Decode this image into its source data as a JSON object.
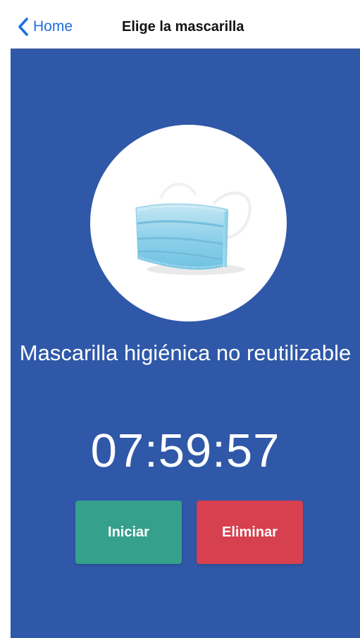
{
  "nav": {
    "back_label": "Home",
    "back_icon": "chevron-left-icon",
    "title": "Elige la mascarilla"
  },
  "mask": {
    "image_icon": "surgical-mask-icon",
    "name": "Mascarilla higiénica no reutilizable"
  },
  "timer": {
    "value": "07:59:57"
  },
  "actions": {
    "start_label": "Iniciar",
    "delete_label": "Eliminar"
  },
  "colors": {
    "background": "#2f58a8",
    "start_button": "#35a08c",
    "delete_button": "#d6404f",
    "link": "#1f6fe0"
  }
}
